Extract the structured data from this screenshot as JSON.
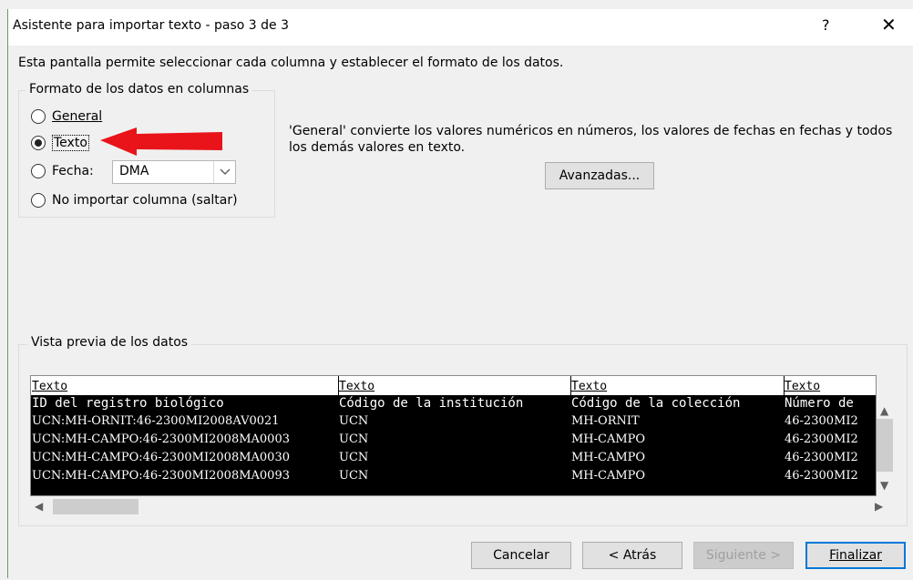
{
  "window": {
    "title": "Asistente para importar texto - paso 3 de 3",
    "help": "?",
    "close": "✕"
  },
  "description": "Esta pantalla permite seleccionar cada columna y establecer el formato de los datos.",
  "format_group": {
    "title": "Formato de los datos en columnas",
    "options": [
      {
        "label": "General",
        "checked": false
      },
      {
        "label": "Texto",
        "checked": true
      },
      {
        "label": "Fecha:",
        "checked": false
      },
      {
        "label": "No importar columna (saltar)",
        "checked": false
      }
    ],
    "date_format": "DMA"
  },
  "note": "'General' convierte los valores numéricos en números, los valores de fechas en fechas y todos los demás valores en texto.",
  "advanced_label": "Avanzadas...",
  "preview": {
    "title": "Vista previa de los datos",
    "headers": [
      "Texto",
      "Texto",
      "Texto",
      "Texto"
    ],
    "rows": [
      [
        "ID del registro biológico",
        "Código de la institución",
        "Código de la colección",
        "Número de"
      ],
      [
        "UCN:MH-ORNIT:46-2300MI2008AV0021",
        "UCN",
        "MH-ORNIT",
        "46-2300MI2"
      ],
      [
        "UCN:MH-CAMPO:46-2300MI2008MA0003",
        "UCN",
        "MH-CAMPO",
        "46-2300MI2"
      ],
      [
        "UCN:MH-CAMPO:46-2300MI2008MA0030",
        "UCN",
        "MH-CAMPO",
        "46-2300MI2"
      ],
      [
        "UCN:MH-CAMPO:46-2300MI2008MA0093",
        "UCN",
        "MH-CAMPO",
        "46-2300MI2"
      ]
    ]
  },
  "buttons": {
    "cancel": "Cancelar",
    "back": "< Atrás",
    "next": "Siguiente >",
    "finish": "Finalizar"
  },
  "colors": {
    "arrow": "#e8141a",
    "preview_bg": "#000000",
    "accent": "#0078d7"
  },
  "icons": {
    "arrow": "red-arrow-left-icon",
    "dropdown": "chevron-down-icon"
  }
}
